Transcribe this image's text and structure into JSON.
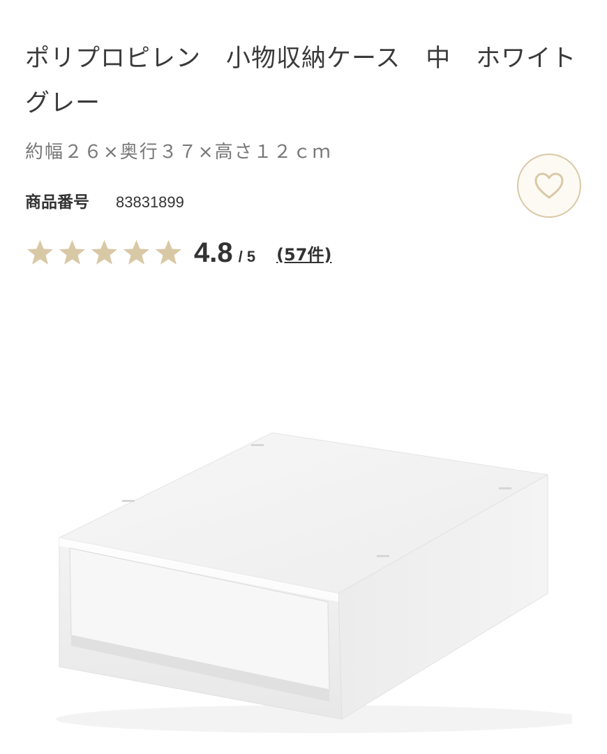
{
  "product": {
    "title": "ポリプロピレン　小物収納ケース　中　ホワイトグレー",
    "size": "約幅２６×奥行３７×高さ１２ｃｍ",
    "product_number_label": "商品番号",
    "product_number": "83831899",
    "rating": {
      "score": "4.8",
      "out_of": "/ 5",
      "stars_filled": 5,
      "review_count": "(57件)"
    },
    "image_icon": "storage-case-image"
  },
  "favorite": {
    "icon": "heart-icon"
  },
  "colors": {
    "star": "#d9c8a6",
    "heart_border": "#d9c8a6",
    "heart_bg": "#fdfaf3",
    "text": "#3a3a3a",
    "subtext": "#777777"
  }
}
